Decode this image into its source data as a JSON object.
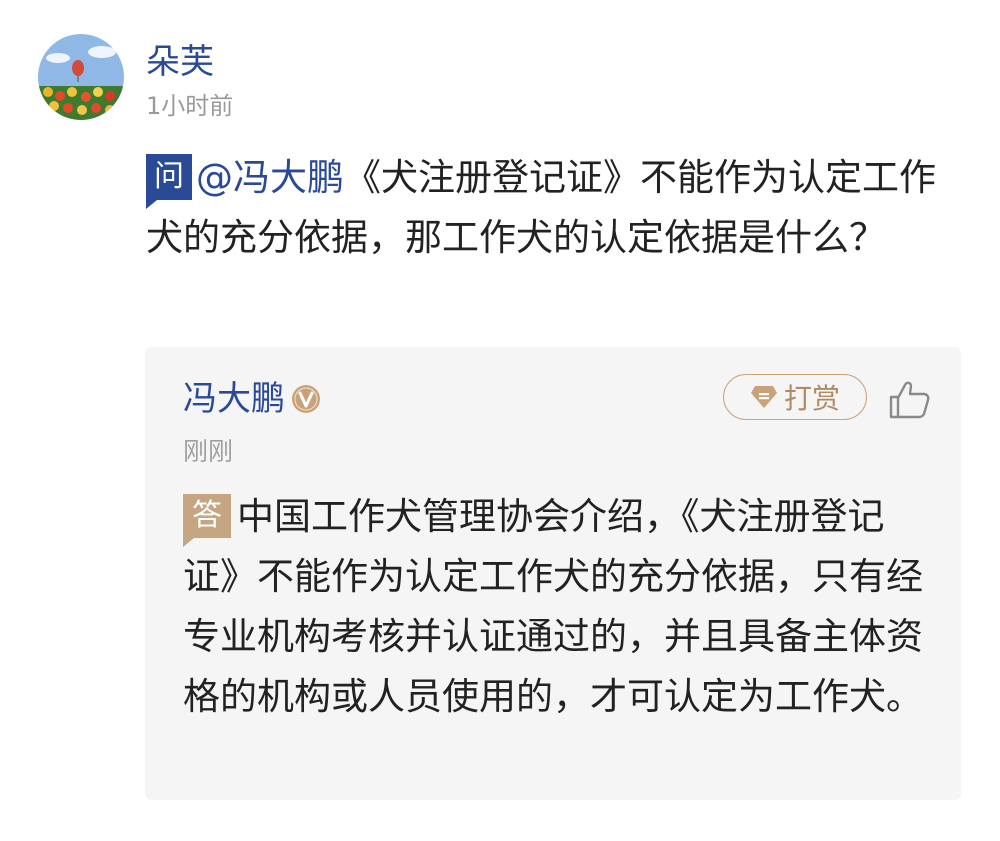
{
  "asker": {
    "name": "朵芙",
    "time": "1小时前"
  },
  "question": {
    "badge": "问",
    "mention": "@冯大鹏",
    "text": "《犬注册登记证》不能作为认定工作犬的充分依据，那工作犬的认定依据是什么？"
  },
  "answer": {
    "name": "冯大鹏",
    "time": "刚刚",
    "tip_label": "打赏",
    "badge": "答",
    "text": "中国工作犬管理协会介绍，《犬注册登记证》不能作为认定工作犬的充分依据，只有经专业机构考核并认证通过的，并且具备主体资格的机构或人员使用的，才可认定为工作犬。"
  },
  "icons": {
    "verified": "verified-icon",
    "tip": "gem-icon",
    "like": "thumbs-up-icon"
  },
  "colors": {
    "accent_blue": "#2a4a96",
    "answer_badge": "#c6a583",
    "tip_border": "#c9a27a",
    "card_bg": "#f5f5f5"
  }
}
